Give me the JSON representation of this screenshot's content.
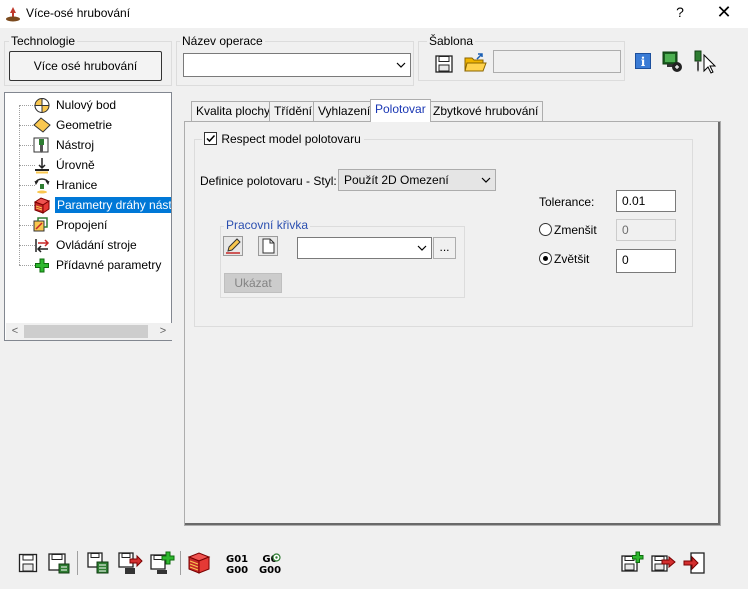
{
  "window": {
    "title": "Více-osé hrubování",
    "help_label": "?",
    "close_label": "✕"
  },
  "technologie": {
    "group_label": "Technologie",
    "button_label": "Více osé hrubování"
  },
  "operace": {
    "group_label": "Název operace",
    "value": ""
  },
  "sablona": {
    "group_label": "Šablona",
    "value": ""
  },
  "tree": {
    "items": [
      {
        "label": "Nulový bod",
        "icon": "zero-point-icon"
      },
      {
        "label": "Geometrie",
        "icon": "geometry-icon"
      },
      {
        "label": "Nástroj",
        "icon": "tool-icon"
      },
      {
        "label": "Úrovně",
        "icon": "levels-icon"
      },
      {
        "label": "Hranice",
        "icon": "boundary-icon"
      },
      {
        "label": "Parametry dráhy nástroje",
        "icon": "toolpath-params-icon",
        "selected": true
      },
      {
        "label": "Propojení",
        "icon": "link-icon"
      },
      {
        "label": "Ovládání stroje",
        "icon": "machine-control-icon"
      },
      {
        "label": "Přídavné parametry",
        "icon": "additional-params-icon"
      }
    ],
    "scroll_left": "<",
    "scroll_right": ">"
  },
  "tabs": [
    {
      "label": "Kvalita plochy"
    },
    {
      "label": "Třídění"
    },
    {
      "label": "Vyhlazení"
    },
    {
      "label": "Polotovar",
      "active": true
    },
    {
      "label": "Zbytkové hrubování"
    }
  ],
  "polotovar": {
    "respect_label": "Respect model polotovaru",
    "respect_checked": true,
    "definice_label": "Definice polotovaru - Styl:",
    "definice_value": "Použít 2D Omezení",
    "tolerance_label": "Tolerance:",
    "tolerance_value": "0.01",
    "zmensit_label": "Zmenšit",
    "zmensit_value": "0",
    "zvetsit_label": "Zvětšit",
    "zvetsit_value": "0",
    "selected_mode": "Zvětšit",
    "krivka_group_label": "Pracovní křivka",
    "krivka_value": "",
    "browse_label": "...",
    "ukazat_label": "Ukázat"
  },
  "bottom_toolbar": {
    "gcode1_top": "G01",
    "gcode1_bottom": "G00",
    "gcode2_top": "G0",
    "gcode2_bottom": "G00"
  },
  "colors": {
    "selection": "#0078d7",
    "active_tab_text": "#1a37b4",
    "group_blue": "#2b4fb0"
  }
}
